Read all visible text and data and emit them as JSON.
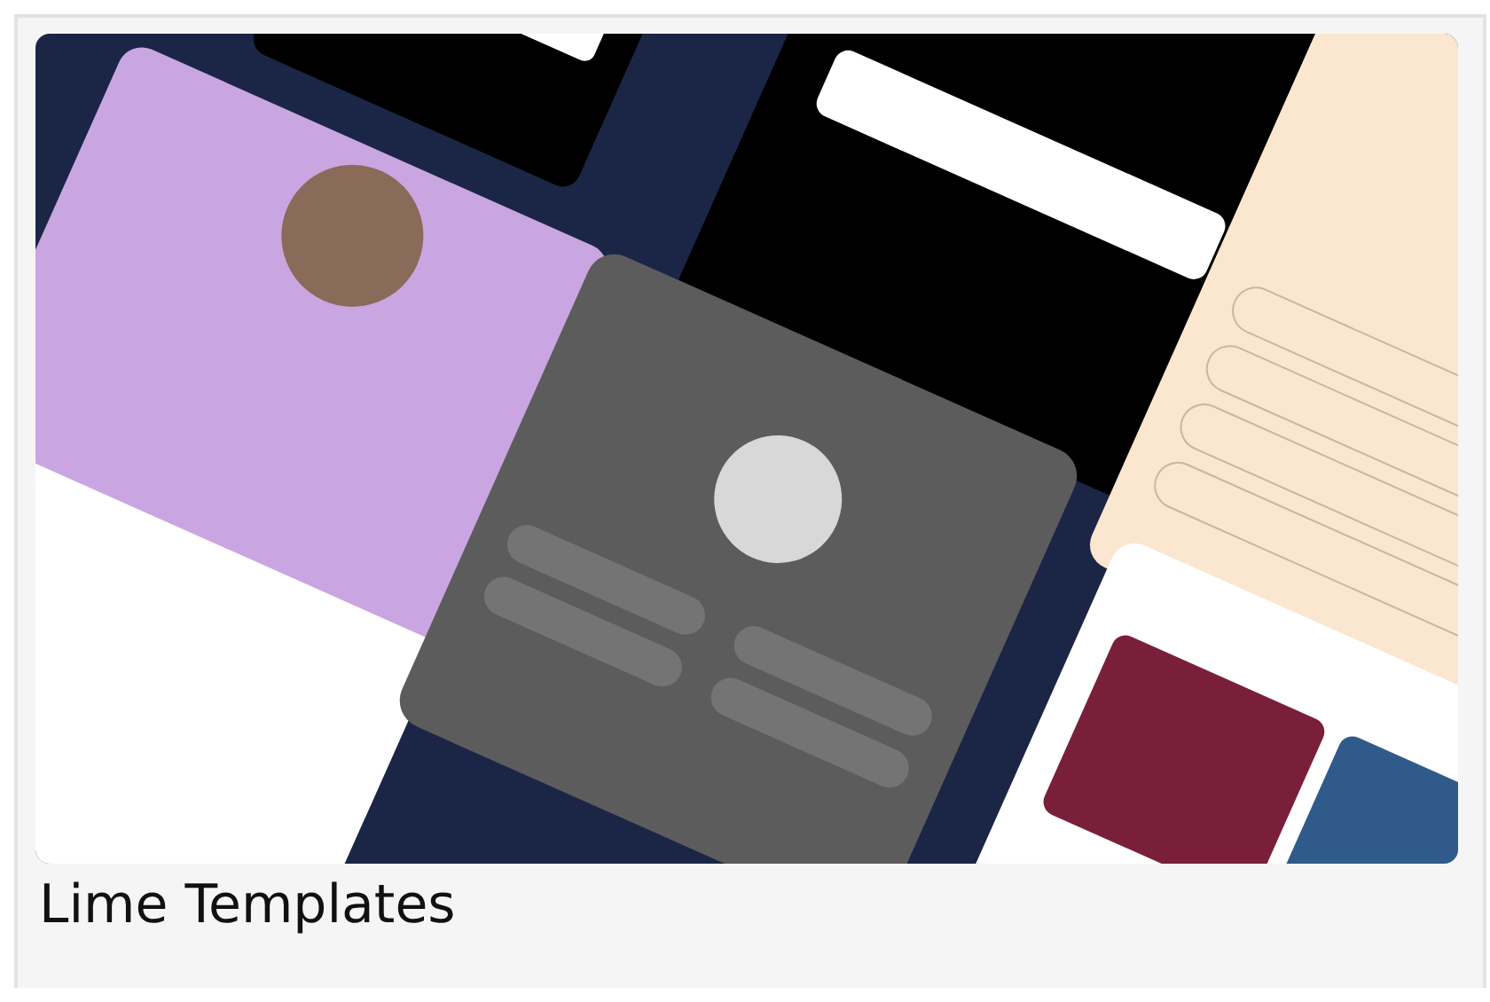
{
  "card": {
    "title": "Lime Templates"
  }
}
